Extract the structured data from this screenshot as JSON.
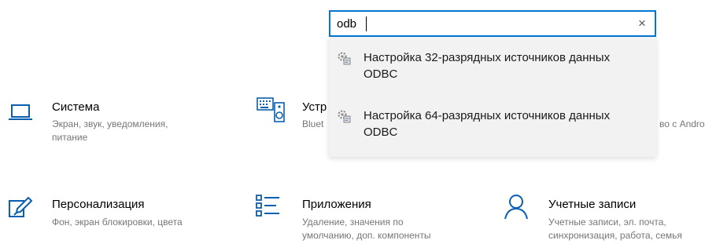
{
  "search": {
    "value": "odb",
    "clear_glyph": "×"
  },
  "suggestions": [
    {
      "label": "Настройка 32-разрядных источников данных ODBC",
      "icon": "admin-tool-icon"
    },
    {
      "label": "Настройка 64-разрядных источников данных ODBC",
      "icon": "admin-tool-icon"
    }
  ],
  "tiles": {
    "system": {
      "title": "Система",
      "desc1": "Экран, звук, уведомления,",
      "desc2": "питание",
      "icon": "laptop-icon"
    },
    "devices": {
      "title": "Устр",
      "desc1": "Bluet",
      "icon": "keyboard-speaker-icon"
    },
    "phone": {
      "desc1": "во с Android,"
    },
    "personalization": {
      "title": "Персонализация",
      "desc1": "Фон, экран блокировки, цвета",
      "icon": "brush-icon"
    },
    "apps": {
      "title": "Приложения",
      "desc1": "Удаление, значения по",
      "desc2": "умолчанию, доп. компоненты",
      "icon": "apps-list-icon"
    },
    "accounts": {
      "title": "Учетные записи",
      "desc1": "Учетные записи, эл. почта,",
      "desc2": "синхронизация, работа, семья",
      "icon": "person-icon"
    }
  },
  "colors": {
    "accent": "#0078d4",
    "dropdown_bg": "#f2f2f2",
    "desc_text": "#767676"
  }
}
